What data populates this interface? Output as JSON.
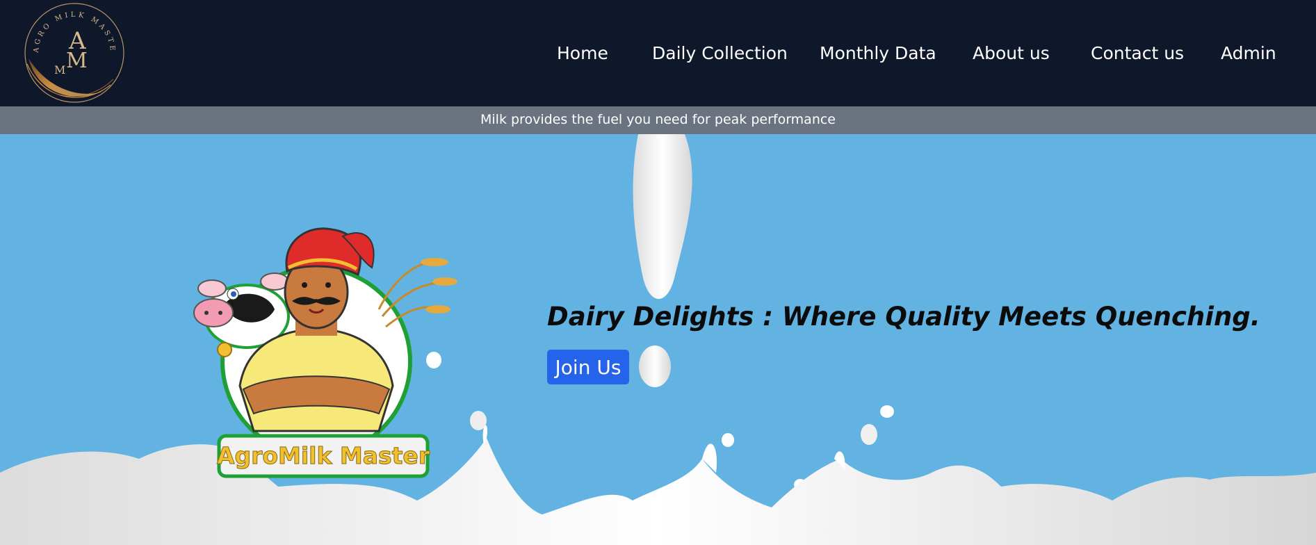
{
  "brand": {
    "logo_ring_text": "AGRO MILK MASTER",
    "logo_monogram_a": "A",
    "logo_monogram_m": "M",
    "logo_monogram_m2": "M"
  },
  "nav": {
    "items": [
      {
        "label": "Home"
      },
      {
        "label": "Daily Collection"
      },
      {
        "label": "Monthly Data"
      },
      {
        "label": "About us"
      },
      {
        "label": "Contact us"
      },
      {
        "label": "Admin"
      }
    ]
  },
  "tagline": "Milk provides the fuel you need for peak performance",
  "hero": {
    "headline": "Dairy Delights : Where Quality Meets Quenching.",
    "cta_label": "Join Us",
    "mascot_banner": "AgroMilk Master"
  },
  "colors": {
    "navbar": "#0f172a",
    "tagline_bar": "#6b7280",
    "hero_bg": "#62b3e2",
    "cta": "#2563eb",
    "logo_gold": "#c9a46b",
    "mascot_green": "#1fa035",
    "turban_red": "#e02b2b",
    "shirt_yellow": "#f6e979"
  }
}
